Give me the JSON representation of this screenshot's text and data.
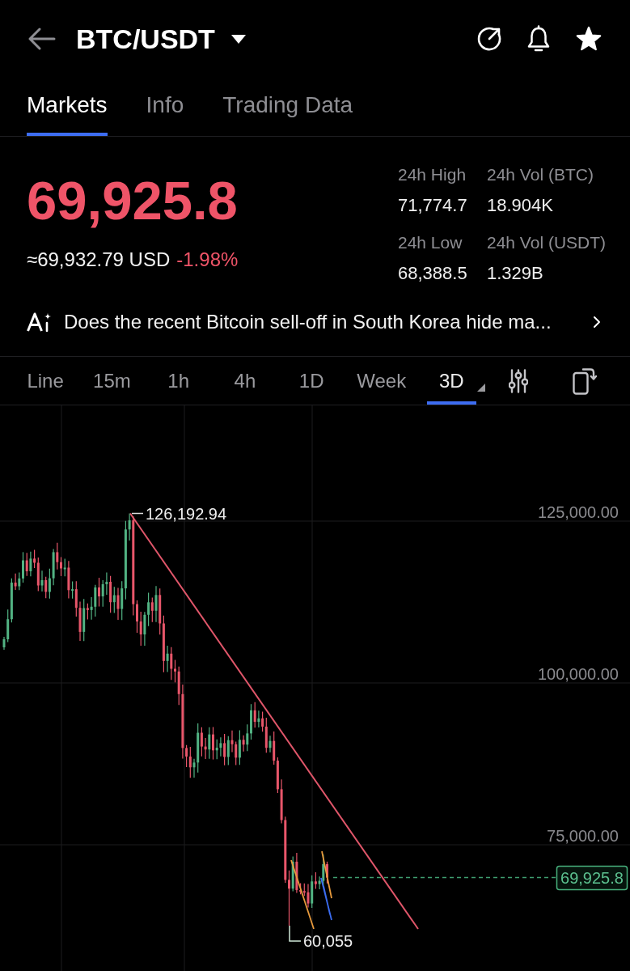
{
  "header": {
    "title": "BTC/USDT",
    "starred": true
  },
  "tabs": [
    {
      "label": "Markets",
      "selected": true
    },
    {
      "label": "Info",
      "selected": false
    },
    {
      "label": "Trading Data",
      "selected": false
    }
  ],
  "ticker": {
    "price": "69,925.8",
    "falling": true,
    "usd_value": "≈69,932.79 USD",
    "change": "-1.98%"
  },
  "stats": [
    {
      "label": "24h High",
      "value": "71,774.7"
    },
    {
      "label": "24h Vol (BTC)",
      "value": "18.904K"
    },
    {
      "label": "24h Low",
      "value": "68,388.5"
    },
    {
      "label": "24h Vol (USDT)",
      "value": "1.329B"
    }
  ],
  "news": {
    "headline": "Does the recent Bitcoin sell-off in South Korea hide ma..."
  },
  "intervals": [
    {
      "label": "Line",
      "selected": false,
      "kind": "option"
    },
    {
      "label": "15m",
      "selected": false,
      "kind": "option"
    },
    {
      "label": "1h",
      "selected": false,
      "kind": "option"
    },
    {
      "label": "4h",
      "selected": false,
      "kind": "option"
    },
    {
      "label": "1D",
      "selected": false,
      "kind": "option"
    },
    {
      "label": "Week",
      "selected": false,
      "kind": "option"
    },
    {
      "label": "3D",
      "selected": true,
      "kind": "dropdown"
    }
  ],
  "chart": {
    "y_axis_labels": [
      "125,000.00",
      "100,000.00",
      "75,000.00"
    ],
    "high_label": "126,192.94",
    "low_label": "60,055",
    "last_price": "69,925.8"
  }
}
